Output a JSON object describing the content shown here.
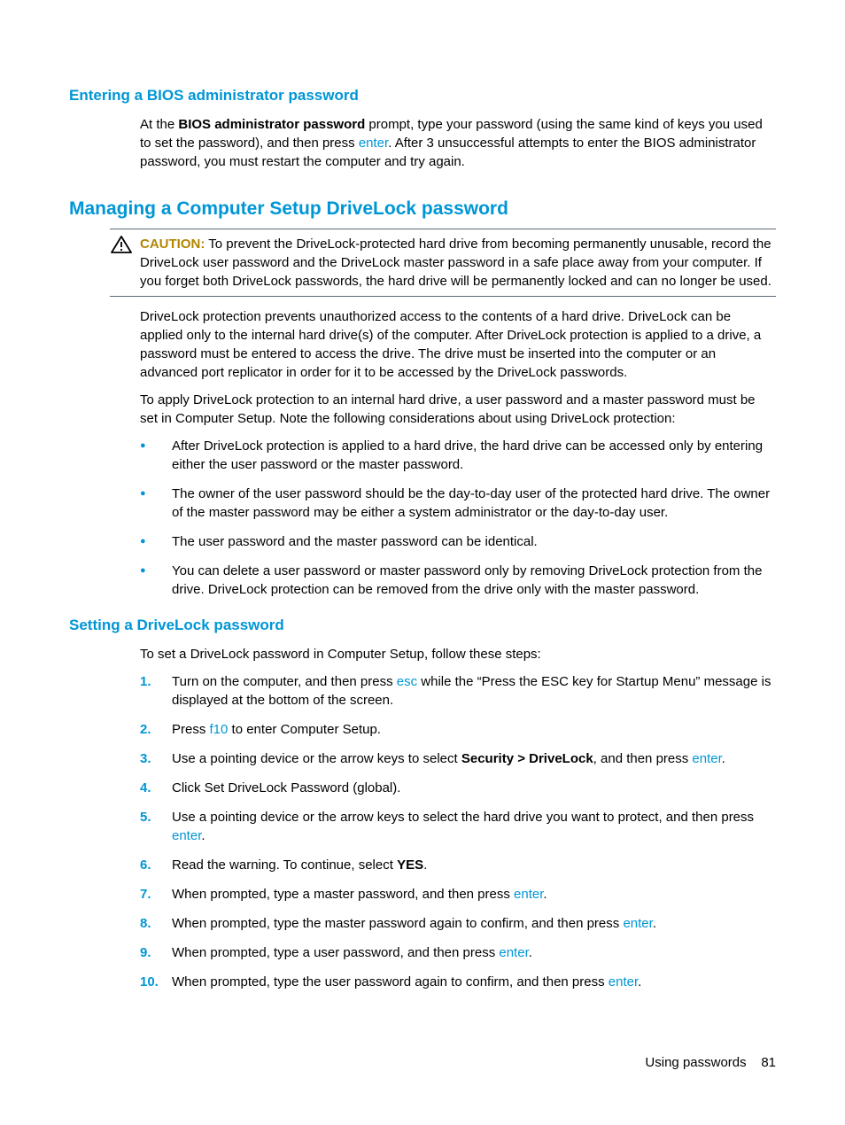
{
  "section1": {
    "heading": "Entering a BIOS administrator password",
    "para_prefix": "At the ",
    "bios_prompt_bold": "BIOS administrator password",
    "para_mid1": " prompt, type your password (using the same kind of keys you used to set the password), and then press ",
    "enter": "enter",
    "para_mid2": ". After 3 unsuccessful attempts to enter the BIOS administrator password, you must restart the computer and try again."
  },
  "section2": {
    "heading": "Managing a Computer Setup DriveLock password",
    "caution_label": "CAUTION:",
    "caution_text": "   To prevent the DriveLock-protected hard drive from becoming permanently unusable, record the DriveLock user password and the DriveLock master password in a safe place away from your computer. If you forget both DriveLock passwords, the hard drive will be permanently locked and can no longer be used.",
    "p1": "DriveLock protection prevents unauthorized access to the contents of a hard drive. DriveLock can be applied only to the internal hard drive(s) of the computer. After DriveLock protection is applied to a drive, a password must be entered to access the drive. The drive must be inserted into the computer or an advanced port replicator in order for it to be accessed by the DriveLock passwords.",
    "p2": "To apply DriveLock protection to an internal hard drive, a user password and a master password must be set in Computer Setup. Note the following considerations about using DriveLock protection:",
    "bullets": [
      "After DriveLock protection is applied to a hard drive, the hard drive can be accessed only by entering either the user password or the master password.",
      "The owner of the user password should be the day-to-day user of the protected hard drive. The owner of the master password may be either a system administrator or the day-to-day user.",
      "The user password and the master password can be identical.",
      "You can delete a user password or master password only by removing DriveLock protection from the drive. DriveLock protection can be removed from the drive only with the master password."
    ]
  },
  "section3": {
    "heading": "Setting a DriveLock password",
    "intro": "To set a DriveLock password in Computer Setup, follow these steps:",
    "steps": {
      "s1a": "Turn on the computer, and then press ",
      "esc": "esc",
      "s1b": " while the “Press the ESC key for Startup Menu” message is displayed at the bottom of the screen.",
      "s2a": "Press ",
      "f10": "f10",
      "s2b": " to enter Computer Setup.",
      "s3a": "Use a pointing device or the arrow keys to select ",
      "s3bold": "Security > DriveLock",
      "s3b": ", and then press ",
      "enter": "enter",
      "s3c": ".",
      "s4": "Click Set DriveLock Password (global).",
      "s5a": "Use a pointing device or the arrow keys to select the hard drive you want to protect, and then press ",
      "s5b": ".",
      "s6a": "Read the warning. To continue, select ",
      "yes": "YES",
      "s6b": ".",
      "s7a": "When prompted, type a master password, and then press ",
      "s7b": ".",
      "s8a": "When prompted, type the master password again to confirm, and then press ",
      "s8b": ".",
      "s9a": "When prompted, type a user password, and then press ",
      "s9b": ".",
      "s10a": "When prompted, type the user password again to confirm, and then press ",
      "s10b": "."
    },
    "nums": [
      "1.",
      "2.",
      "3.",
      "4.",
      "5.",
      "6.",
      "7.",
      "8.",
      "9.",
      "10."
    ]
  },
  "footer": {
    "label": "Using passwords",
    "page": "81"
  }
}
